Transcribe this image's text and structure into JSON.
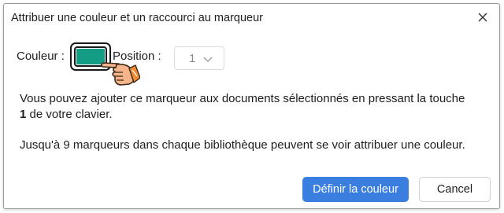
{
  "dialog": {
    "title": "Attribuer une couleur et un raccourci au marqueur",
    "close_icon": "close-icon"
  },
  "color": {
    "label": "Couleur :",
    "value": "#139d85"
  },
  "position": {
    "label": "Position :",
    "selected": "1",
    "chevron_icon": "chevron-down-icon"
  },
  "info": {
    "line1": "Vous pouvez ajouter ce marqueur aux documents sélectionnés en pressant la touche",
    "key": "1",
    "line2_rest": " de votre clavier.",
    "line3": "Jusqu'à 9 marqueurs dans chaque bibliothèque peuvent se voir attribuer une couleur."
  },
  "buttons": {
    "define_color": "Définir la couleur",
    "cancel": "Cancel"
  },
  "colors": {
    "primary_button": "#3a7ee0",
    "hand_fill": "#f6b48b",
    "hand_stroke": "#e07a2a"
  }
}
